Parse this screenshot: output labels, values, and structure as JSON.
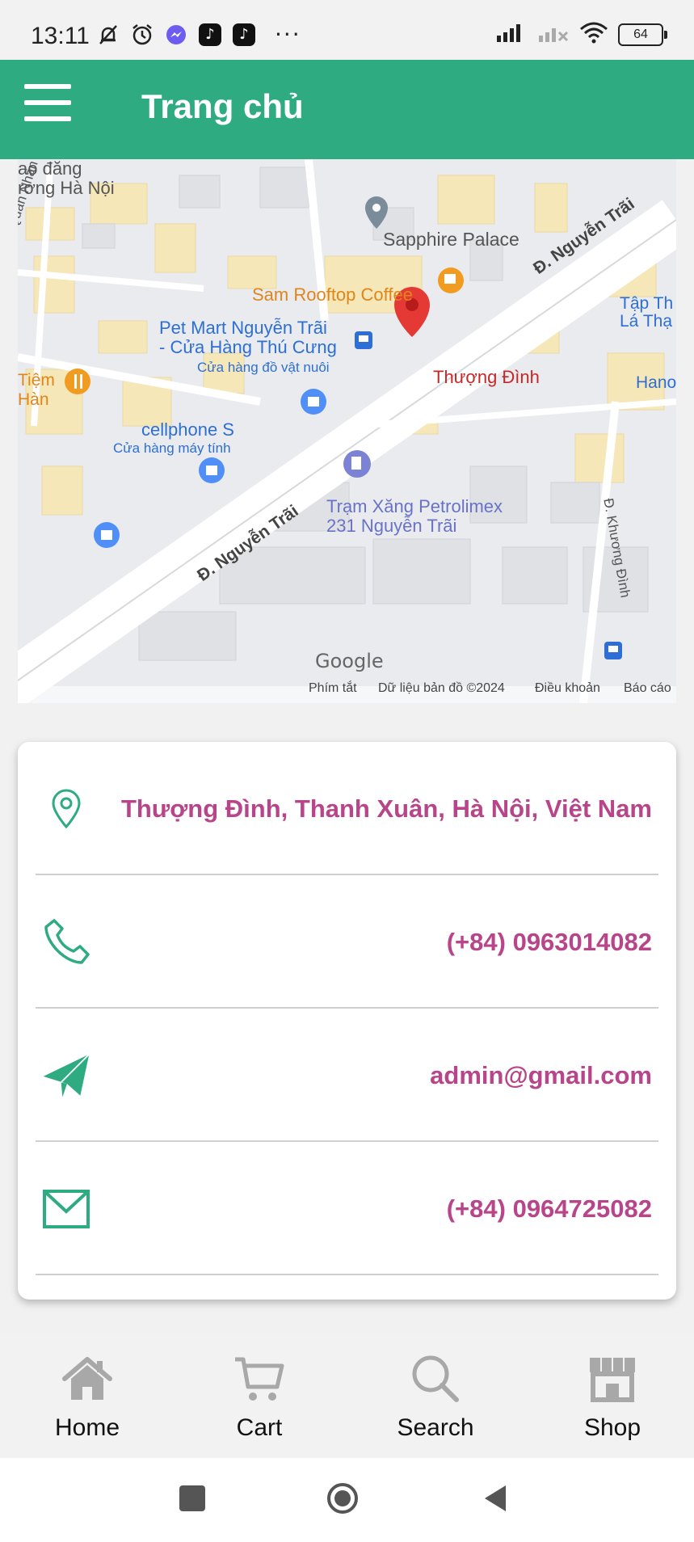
{
  "status_bar": {
    "time": "13:11",
    "battery": "64"
  },
  "header": {
    "title": "Trang chủ"
  },
  "map": {
    "labels": {
      "area_top_left": "ao đăng\nrơng Hà Nội",
      "street_quan_nhan": "P. Quan Nhân",
      "sapphire": "Sapphire Palace",
      "sam_coffee": "Sam Rooftop Coffee",
      "nguyen_trai_upper": "Đ. Nguyễn Trãi",
      "petmart": "Pet Mart Nguyễn Trãi\n- Cửa Hàng Thú Cưng",
      "petmart_sub": "Cửa hàng đồ vật nuôi",
      "thuong_dinh": "Thượng Đình",
      "tap_the": "Tập Th\nLá Thạ",
      "hanoi_right": "Hano",
      "cellphones": "cellphone S",
      "cellphones_sub": "Cửa hàng máy tính",
      "tiem_han": "Tiệm\nHàn",
      "petrolimex": "Trạm Xăng Petrolimex\n231 Nguyễn Trãi",
      "nguyen_trai_lower": "Đ. Nguyễn Trãi",
      "khuong_dinh": "Đ. Khương Đình",
      "google": "Google"
    },
    "footer": [
      "Phím tắt",
      "Dữ liệu bản đồ ©2024",
      "Điều khoản",
      "Báo cáo"
    ]
  },
  "contact": {
    "address": "Thượng Đình, Thanh Xuân, Hà Nội, Việt Nam",
    "phone": "(+84) 0963014082",
    "email": "admin@gmail.com",
    "fax": "(+84) 0964725082"
  },
  "bottom_nav": [
    {
      "label": "Home",
      "icon": "home-icon"
    },
    {
      "label": "Cart",
      "icon": "cart-icon"
    },
    {
      "label": "Search",
      "icon": "search-icon"
    },
    {
      "label": "Shop",
      "icon": "shop-icon"
    }
  ],
  "colors": {
    "primary": "#2eab80",
    "accent_text": "#b8458a",
    "nav_icon": "#a8a8a8"
  }
}
